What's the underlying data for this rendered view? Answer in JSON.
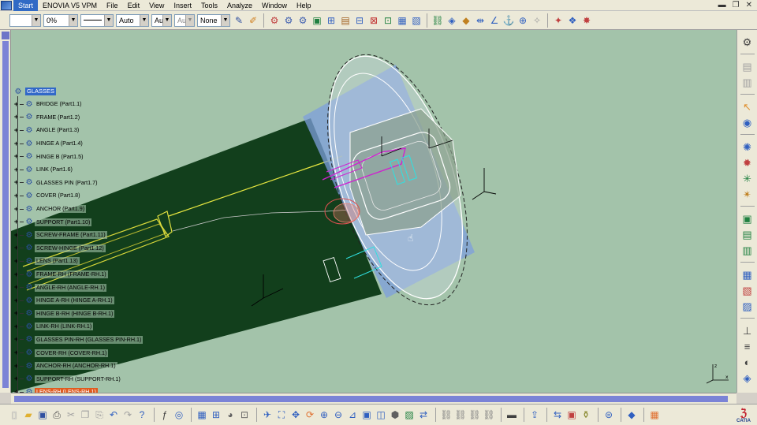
{
  "menu": {
    "items": [
      "Start",
      "ENOVIA V5 VPM",
      "File",
      "Edit",
      "View",
      "Insert",
      "Tools",
      "Analyze",
      "Window",
      "Help"
    ],
    "active_index": 0
  },
  "toolbar": {
    "color_combo": "",
    "transparency_combo": "0%",
    "line_combo": "",
    "weight_combo": "Auto",
    "layer_combo": "Aut",
    "linetype_combo": "Aut",
    "layer_name_combo": "None"
  },
  "spec_tree": {
    "root": "GLASSES",
    "nodes": [
      {
        "label": "BRIDGE (Part1.1)",
        "highlighted": false
      },
      {
        "label": "FRAME (Part1.2)",
        "highlighted": false
      },
      {
        "label": "ANGLE (Part1.3)",
        "highlighted": false
      },
      {
        "label": "HINGE A (Part1.4)",
        "highlighted": false
      },
      {
        "label": "HINGE B (Part1.5)",
        "highlighted": false
      },
      {
        "label": "LINK (Part1.6)",
        "highlighted": false
      },
      {
        "label": "GLASSES PIN (Part1.7)",
        "highlighted": false
      },
      {
        "label": "COVER (Part1.8)",
        "highlighted": false
      },
      {
        "label": "ANCHOR (Part1.9)",
        "highlighted": false
      },
      {
        "label": "SUPPORT (Part1.10)",
        "highlighted": false
      },
      {
        "label": "SCREW-FRAME (Part1.11)",
        "highlighted": false
      },
      {
        "label": "SCREW-HINGE (Part1.12)",
        "highlighted": false
      },
      {
        "label": "LENS (Part1.13)",
        "highlighted": false
      },
      {
        "label": "FRAME-RH (FRAME-RH.1)",
        "highlighted": false
      },
      {
        "label": "ANGLE-RH (ANGLE-RH.1)",
        "highlighted": false
      },
      {
        "label": "HINGE A-RH (HINGE A-RH.1)",
        "highlighted": false
      },
      {
        "label": "HINGE B-RH (HINGE B-RH.1)",
        "highlighted": false
      },
      {
        "label": "LINK-RH (LINK-RH.1)",
        "highlighted": false
      },
      {
        "label": "GLASSES PIN-RH (GLASSES PIN-RH.1)",
        "highlighted": false
      },
      {
        "label": "COVER-RH (COVER-RH.1)",
        "highlighted": false
      },
      {
        "label": "ANCHOR-RH (ANCHOR-RH.1)",
        "highlighted": false
      },
      {
        "label": "SUPPORT-RH (SUPPORT-RH.1)",
        "highlighted": false
      },
      {
        "label": "LENS-RH (LENS-RH.1)",
        "highlighted": true
      }
    ]
  },
  "compass_labels": {
    "z": "z",
    "x": "x"
  },
  "brand": {
    "logo_text": "CATIA"
  },
  "colors": {
    "viewport_bg": "#a3c3aa",
    "tree_selection": "#3168c8",
    "tree_highlight": "#e05b1f",
    "model_dark_green": "#123f1c",
    "plane_blue": "#7d9fdc"
  }
}
